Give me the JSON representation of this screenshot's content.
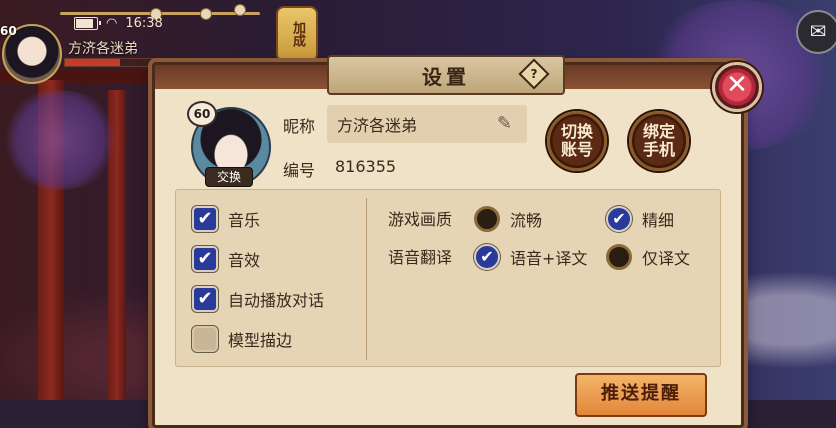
{
  "status_bar": {
    "time": "16:38"
  },
  "hud": {
    "player_name": "方济各迷弟",
    "level": "60",
    "side_banner": "加成",
    "hp_fraction": 0.55
  },
  "dialog": {
    "title": "设置",
    "help_symbol": "?",
    "close_symbol": "✕"
  },
  "profile": {
    "avatar_level": "60",
    "avatar_switch_label": "交换",
    "nickname_label": "昵称",
    "nickname": "方济各迷弟",
    "id_label": "编号",
    "id_value": "816355",
    "switch_account_label": "切换\n账号",
    "bind_phone_label": "绑定\n手机"
  },
  "options": {
    "toggles": [
      {
        "label": "音乐",
        "checked": true
      },
      {
        "label": "音效",
        "checked": true
      },
      {
        "label": "自动播放对话",
        "checked": true
      },
      {
        "label": "模型描边",
        "checked": false
      }
    ],
    "quality": {
      "label": "游戏画质",
      "choices": [
        {
          "label": "流畅",
          "selected": false
        },
        {
          "label": "精细",
          "selected": true
        }
      ]
    },
    "voice": {
      "label": "语音翻译",
      "choices": [
        {
          "label": "语音+译文",
          "selected": true
        },
        {
          "label": "仅译文",
          "selected": false
        }
      ]
    }
  },
  "push_button_label": "推送提醒",
  "colors": {
    "panel_bg": "#efe2c7",
    "checkbox_on": "#2a3a9a",
    "close_button": "#e04a5a",
    "push_button": "#f3b56a"
  },
  "icons": [
    "battery-icon",
    "wifi-icon",
    "mail-icon",
    "help-icon",
    "close-icon",
    "edit-pencil-icon",
    "check-icon"
  ]
}
